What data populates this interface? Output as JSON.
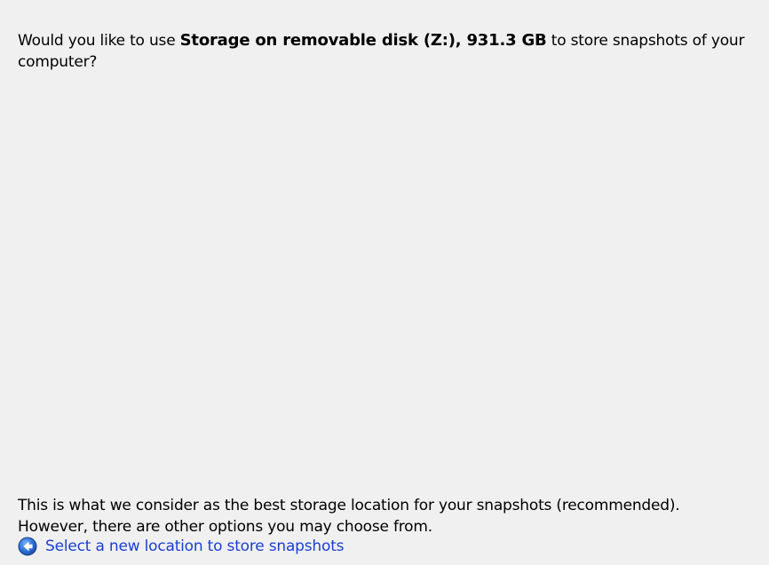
{
  "question": {
    "prefix": "Would you like to use ",
    "target": "Storage on removable disk (Z:), 931.3 GB",
    "suffix": " to store snapshots of your computer?"
  },
  "recommendation": {
    "line1": "This is what we consider as the best storage location for your snapshots (recommended).",
    "line2": "However, there are other options you may choose from."
  },
  "link": {
    "icon": "back-arrow-icon",
    "label": "Select a new location to store snapshots",
    "color": "#1a3fd4"
  },
  "colors": {
    "background": "#f0f0f0",
    "icon_blue": "#2a6fd6"
  }
}
